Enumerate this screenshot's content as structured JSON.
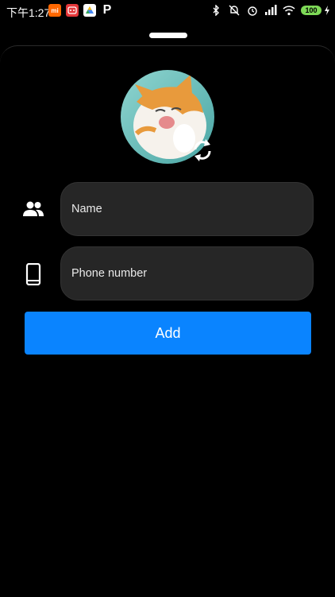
{
  "status_bar": {
    "time": "下午1:27",
    "app_icons": [
      {
        "name": "mi-icon",
        "label": "mi"
      },
      {
        "name": "tmall-icon",
        "label": "TMALL"
      },
      {
        "name": "drive-icon",
        "label": ""
      },
      {
        "name": "p-icon",
        "label": "P"
      }
    ],
    "battery": "100",
    "icon_names": [
      "bluetooth-icon",
      "mute-icon",
      "alarm-icon",
      "signal-icon",
      "wifi-icon",
      "battery-icon",
      "charging-icon"
    ]
  },
  "form": {
    "name_placeholder": "Name",
    "phone_placeholder": "Phone number",
    "add_label": "Add"
  },
  "colors": {
    "accent": "#0a84ff",
    "field_bg": "#262626",
    "battery": "#7ed957"
  }
}
